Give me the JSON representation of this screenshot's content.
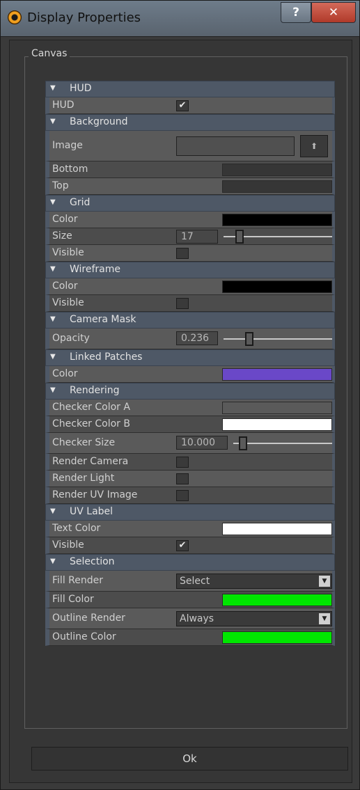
{
  "window": {
    "title": "Display Properties",
    "help_label": "?",
    "close_label": "✕"
  },
  "group": {
    "label": "Canvas"
  },
  "sections": {
    "hud": {
      "title": "HUD",
      "hud_label": "HUD",
      "hud_checked": true
    },
    "background": {
      "title": "Background",
      "image_label": "Image",
      "bottom_label": "Bottom",
      "top_label": "Top",
      "bottom_color": "#363636",
      "top_color": "#363636"
    },
    "grid": {
      "title": "Grid",
      "color_label": "Color",
      "color": "#000000",
      "size_label": "Size",
      "size_value": "17",
      "size_level": 0.15,
      "visible_label": "Visible",
      "visible_checked": false
    },
    "wireframe": {
      "title": "Wireframe",
      "color_label": "Color",
      "color": "#000000",
      "visible_label": "Visible",
      "visible_checked": false
    },
    "camera_mask": {
      "title": "Camera Mask",
      "opacity_label": "Opacity",
      "opacity_value": "0.236",
      "opacity_level": 0.236
    },
    "linked_patches": {
      "title": "Linked Patches",
      "color_label": "Color",
      "color": "#6a48c8"
    },
    "rendering": {
      "title": "Rendering",
      "checker_a_label": "Checker Color A",
      "checker_a_color": "#5a5a5a",
      "checker_b_label": "Checker Color B",
      "checker_b_color": "#ffffff",
      "checker_size_label": "Checker Size",
      "checker_size_value": "10.000",
      "checker_size_level": 0.1,
      "render_camera_label": "Render Camera",
      "render_light_label": "Render Light",
      "render_uv_label": "Render UV Image"
    },
    "uv_label": {
      "title": "UV Label",
      "text_color_label": "Text Color",
      "text_color": "#ffffff",
      "visible_label": "Visible",
      "visible_checked": true
    },
    "selection": {
      "title": "Selection",
      "fill_render_label": "Fill Render",
      "fill_render_value": "Select",
      "fill_color_label": "Fill Color",
      "fill_color": "#00e600",
      "outline_render_label": "Outline Render",
      "outline_render_value": "Always",
      "outline_color_label": "Outline Color",
      "outline_color": "#00e600"
    }
  },
  "footer": {
    "ok_label": "Ok"
  }
}
